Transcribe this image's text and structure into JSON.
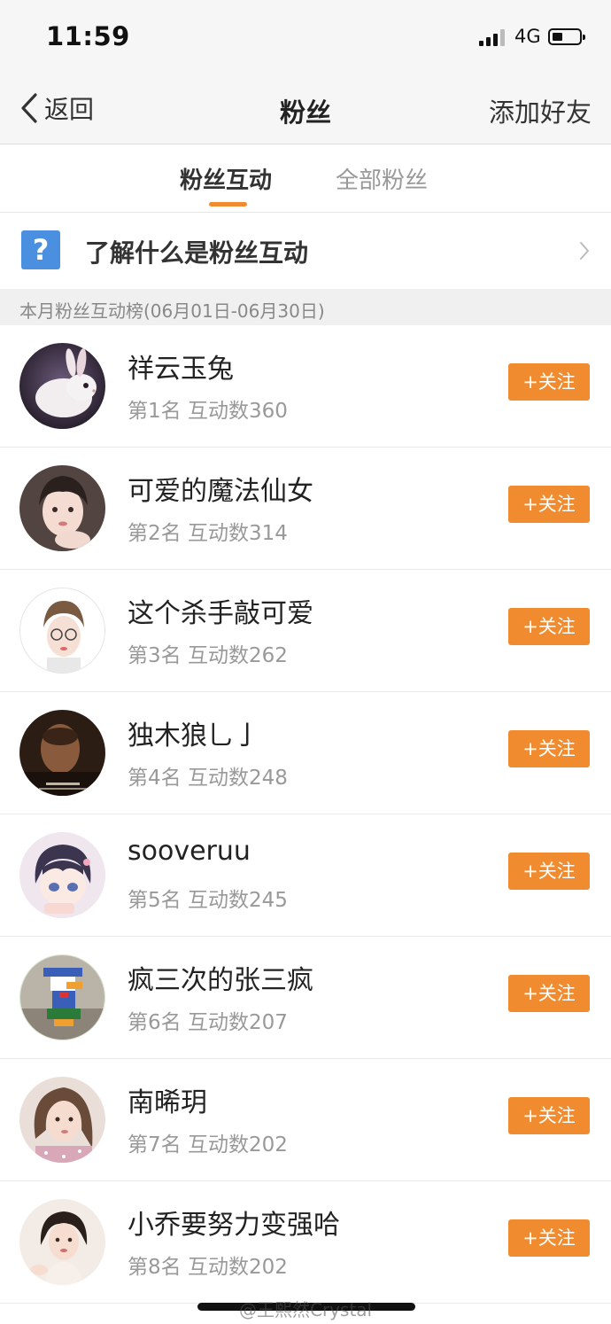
{
  "status_bar": {
    "time": "11:59",
    "network": "4G"
  },
  "nav": {
    "back_label": "返回",
    "title": "粉丝",
    "action_label": "添加好友"
  },
  "tabs": [
    {
      "label": "粉丝互动",
      "active": true
    },
    {
      "label": "全部粉丝",
      "active": false
    }
  ],
  "info": {
    "text": "了解什么是粉丝互动",
    "icon": "question-icon"
  },
  "section_header": "本月粉丝互动榜(06月01日-06月30日)",
  "follow_label": "+关注",
  "colors": {
    "accent": "#f08c2f",
    "question_icon_bg": "#4a8fe0"
  },
  "fans": [
    {
      "name": "祥云玉兔",
      "stat": "第1名 互动数360",
      "avatar": "rabbit"
    },
    {
      "name": "可爱的魔法仙女",
      "stat": "第2名 互动数314",
      "avatar": "girl-portrait"
    },
    {
      "name": "这个杀手敲可爱",
      "stat": "第3名 互动数262",
      "avatar": "girl-glasses"
    },
    {
      "name": "独木狼乚亅",
      "stat": "第4名 互动数248",
      "avatar": "movie-still"
    },
    {
      "name": "sooveruu",
      "stat": "第5名 互动数245",
      "avatar": "anime-girl"
    },
    {
      "name": "疯三次的张三疯",
      "stat": "第6名 互动数207",
      "avatar": "duck-cartoon"
    },
    {
      "name": "南晞玥",
      "stat": "第7名 互动数202",
      "avatar": "woman-portrait"
    },
    {
      "name": "小乔要努力变强哈",
      "stat": "第8名 互动数202",
      "avatar": "woman-portrait-2"
    }
  ],
  "watermark": "@王熙然Crystal"
}
